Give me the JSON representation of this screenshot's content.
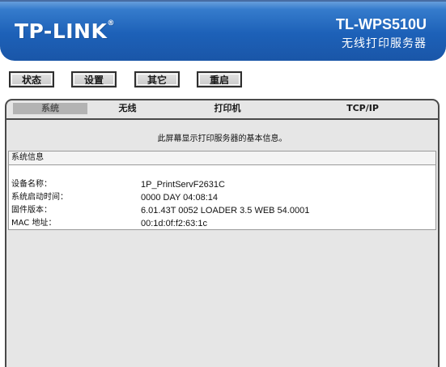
{
  "header": {
    "logo": "TP-LINK",
    "logo_reg": "®",
    "model": "TL-WPS510U",
    "subtitle": "无线打印服务器"
  },
  "menu": [
    {
      "label": "状态"
    },
    {
      "label": "设置"
    },
    {
      "label": "其它"
    },
    {
      "label": "重启"
    }
  ],
  "subtabs": [
    {
      "label": "系统",
      "active": true
    },
    {
      "label": "无线"
    },
    {
      "label": "打印机"
    },
    {
      "label": "TCP/IP"
    }
  ],
  "info_text": "此屏幕显示打印服务器的基本信息。",
  "system_info": {
    "title": "系统信息",
    "rows": [
      {
        "label": "设备名称：",
        "value": "1P_PrintServF2631C"
      },
      {
        "label": "系统启动时间：",
        "value": "0000 DAY 04:08:14"
      },
      {
        "label": "固件版本：",
        "value": "6.01.43T 0052 LOADER 3.5 WEB 54.0001"
      },
      {
        "label": "MAC 地址：",
        "value": "00:1d:0f:f2:63:1c"
      }
    ]
  }
}
